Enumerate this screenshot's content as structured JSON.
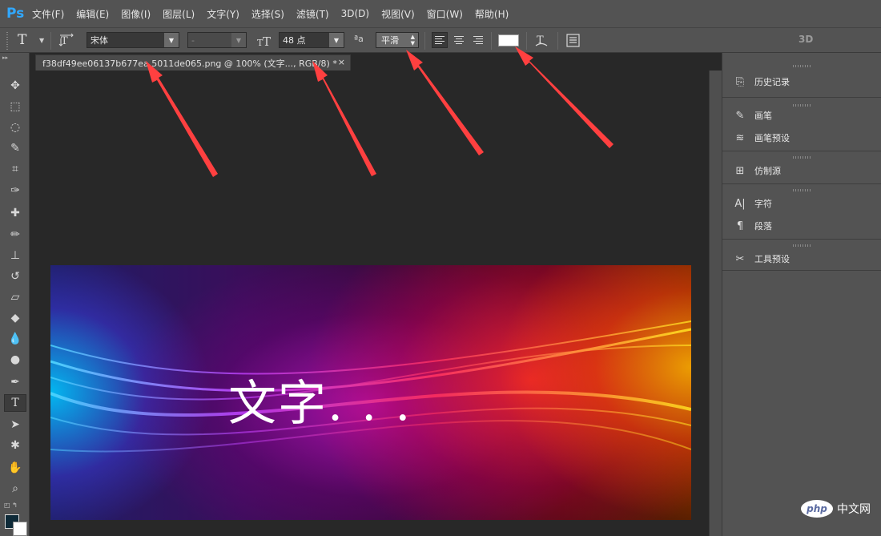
{
  "app": {
    "logo": "Ps"
  },
  "menu": [
    {
      "label": "文件(F)"
    },
    {
      "label": "编辑(E)"
    },
    {
      "label": "图像(I)"
    },
    {
      "label": "图层(L)"
    },
    {
      "label": "文字(Y)"
    },
    {
      "label": "选择(S)"
    },
    {
      "label": "滤镜(T)"
    },
    {
      "label": "3D(D)"
    },
    {
      "label": "视图(V)"
    },
    {
      "label": "窗口(W)"
    },
    {
      "label": "帮助(H)"
    }
  ],
  "options": {
    "tool_glyph": "T",
    "font_family": "宋体",
    "font_style": "-",
    "font_size": "48 点",
    "aa_icon": "ªa",
    "antialias": "平滑",
    "text_color": "#ffffff",
    "threed": "3D"
  },
  "document": {
    "tab_title": "f38df49ee06137b677ea  5011de065.png @ 100% (文字..., RGB/8) *",
    "close_glyph": "×",
    "canvas_text": "文字. . ."
  },
  "tools": [
    {
      "icon": "move-icon",
      "glyph": "✥"
    },
    {
      "icon": "marquee-icon",
      "glyph": "⬚"
    },
    {
      "icon": "lasso-icon",
      "glyph": "◌"
    },
    {
      "icon": "quick-select-icon",
      "glyph": "✎"
    },
    {
      "icon": "crop-icon",
      "glyph": "⌗"
    },
    {
      "icon": "eyedropper-icon",
      "glyph": "✑"
    },
    {
      "icon": "healing-brush-icon",
      "glyph": "✚"
    },
    {
      "icon": "brush-icon",
      "glyph": "✏"
    },
    {
      "icon": "clone-stamp-icon",
      "glyph": "⊥"
    },
    {
      "icon": "history-brush-icon",
      "glyph": "↺"
    },
    {
      "icon": "eraser-icon",
      "glyph": "▱"
    },
    {
      "icon": "paint-bucket-icon",
      "glyph": "◆"
    },
    {
      "icon": "blur-icon",
      "glyph": "💧"
    },
    {
      "icon": "dodge-icon",
      "glyph": "●"
    },
    {
      "icon": "pen-icon",
      "glyph": "✒"
    },
    {
      "icon": "type-icon",
      "glyph": "T"
    },
    {
      "icon": "path-select-icon",
      "glyph": "➤"
    },
    {
      "icon": "custom-shape-icon",
      "glyph": "✱"
    },
    {
      "icon": "hand-icon",
      "glyph": "✋"
    },
    {
      "icon": "zoom-icon",
      "glyph": "⌕"
    }
  ],
  "panels": [
    {
      "name": "history",
      "label": "历史记录",
      "glyph": "⎘"
    },
    {
      "name": "brush",
      "label": "画笔",
      "glyph": "✎"
    },
    {
      "name": "brush-presets",
      "label": "画笔预设",
      "glyph": "≋"
    },
    {
      "name": "clone-source",
      "label": "仿制源",
      "glyph": "⊞"
    },
    {
      "name": "character",
      "label": "字符",
      "glyph": "A|"
    },
    {
      "name": "paragraph",
      "label": "段落",
      "glyph": "¶"
    },
    {
      "name": "tool-presets",
      "label": "工具预设",
      "glyph": "✂"
    }
  ],
  "colors": {
    "foreground": "#0e2a38",
    "background": "#ffffff",
    "annotation_arrow": "#ff4040"
  },
  "watermark": {
    "logo": "php",
    "text": "中文网"
  }
}
